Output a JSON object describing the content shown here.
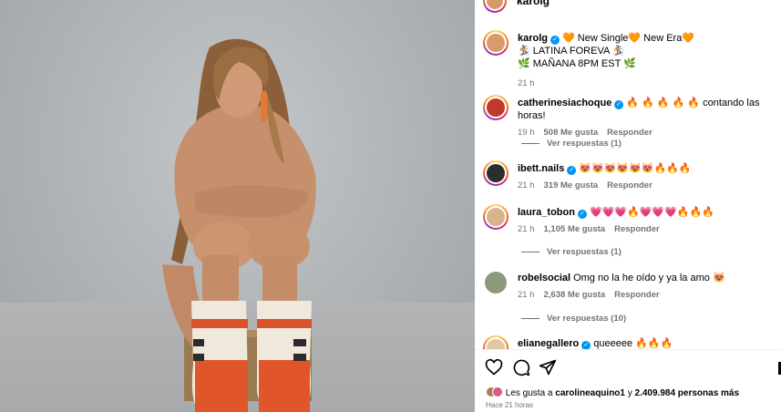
{
  "post": {
    "author": "karolg",
    "caption_line1": "🧡 New Single🧡 New Era🧡",
    "caption_line2": "🏂 LATINA FOREVA 🏂",
    "caption_line3": "🌿 MAÑANA 8PM EST 🌿",
    "time": "21 h"
  },
  "comments": [
    {
      "user": "catherinesiachoque",
      "verified": true,
      "text": "🔥 🔥 🔥 🔥 🔥 contando las horas!",
      "time": "19 h",
      "likes": "508 Me gusta",
      "reply": "Responder",
      "view_replies": "Ver respuestas (1)"
    },
    {
      "user": "ibett.nails",
      "verified": true,
      "text": "😻😻😻😻😻😻🔥🔥🔥",
      "time": "21 h",
      "likes": "319 Me gusta",
      "reply": "Responder",
      "view_replies": ""
    },
    {
      "user": "laura_tobon",
      "verified": true,
      "text": "💗💗💗🔥💗💗💗🔥🔥🔥",
      "time": "21 h",
      "likes": "1,105 Me gusta",
      "reply": "Responder",
      "view_replies": "Ver respuestas (1)"
    },
    {
      "user": "robelsocial",
      "verified": false,
      "text": "Omg no la he oído y ya la amo 😻",
      "time": "21 h",
      "likes": "2,638 Me gusta",
      "reply": "Responder",
      "view_replies": "Ver respuestas (10)"
    },
    {
      "user": "elianegallero",
      "verified": true,
      "text": "queeeee 🔥🔥🔥",
      "time": "",
      "likes": "",
      "reply": "",
      "view_replies": ""
    }
  ],
  "likes": {
    "prefix": "Les gusta a",
    "first_liker": "carolineaquino1",
    "connector": "y",
    "count": "2.409.984 personas más"
  },
  "date_text": "Hace 21 horas",
  "icons": {
    "like": "heart-icon",
    "comment": "comment-bubble-icon",
    "share": "paper-plane-icon"
  }
}
